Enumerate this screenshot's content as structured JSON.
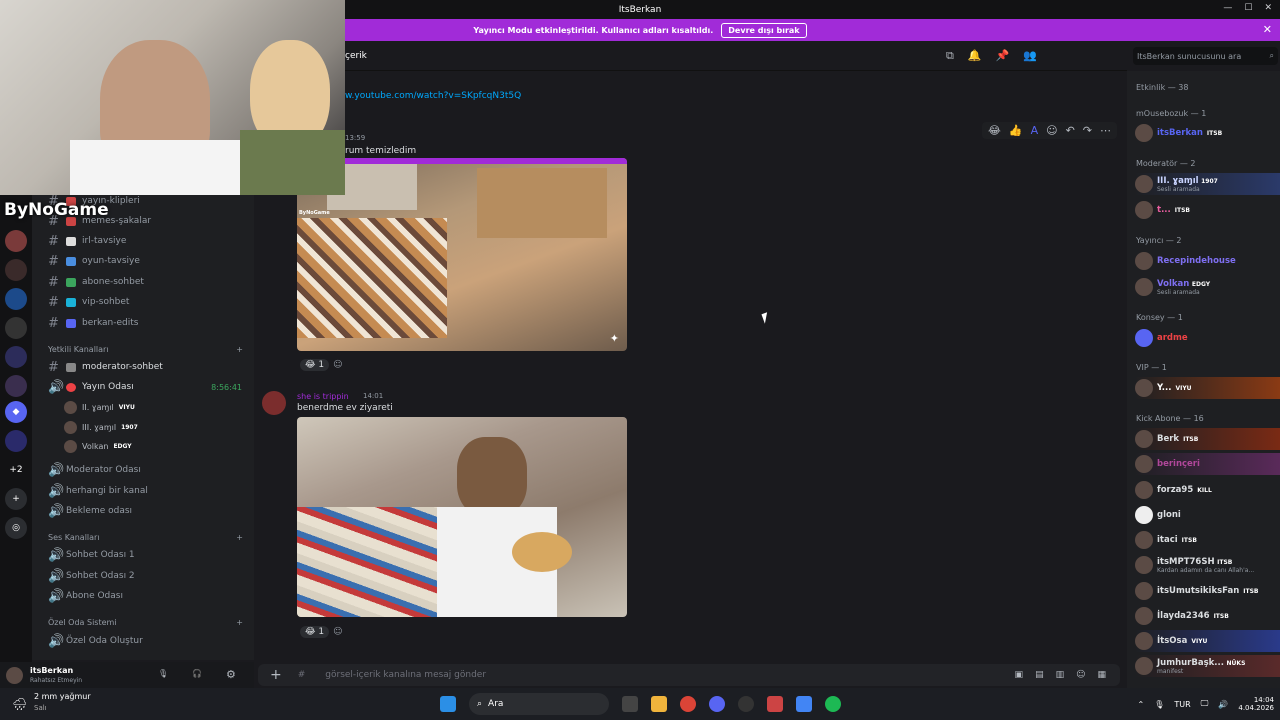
{
  "window": {
    "title": "ItsBerkan",
    "controls": [
      "—",
      "☐",
      "✕"
    ]
  },
  "banner": {
    "text": "Yayıncı Modu etkinleştirildi. Kullanıcı adları kısaltıldı.",
    "button": "Devre dışı bırak",
    "close": "✕"
  },
  "webcam": {
    "logo": "ByNoGame"
  },
  "header": {
    "channel": "çerik",
    "search_placeholder": "ItsBerkan sunucusunu ara"
  },
  "channels": {
    "text": [
      {
        "label": "yayın-klipleri"
      },
      {
        "label": "memes-şakalar"
      },
      {
        "label": "irl-tavsiye"
      },
      {
        "label": "oyun-tavsiye"
      },
      {
        "label": "abone-sohbet"
      },
      {
        "label": "vip-sohbet"
      },
      {
        "label": "berkan-edits"
      }
    ],
    "yetkili_cat": "Yetkili Kanalları",
    "moderator_sohbet": "moderator-sohbet",
    "yayin_odasi": "Yayın Odası",
    "yayin_timer": "8:56:41",
    "voice_users": [
      {
        "name": "II. ɣaɱıl",
        "badge": "VIYU"
      },
      {
        "name": "III. ɣaɱıl",
        "badge": "1907"
      },
      {
        "name": "Volkan",
        "badge": "EDGY"
      }
    ],
    "moderator_odasi": "Moderator Odası",
    "herhangi": "herhangi bir kanal",
    "bekleme": "Bekleme odası",
    "ses_cat": "Ses Kanalları",
    "ses": [
      "Sohbet Odası 1",
      "Sohbet Odası 2",
      "Abone Odası"
    ],
    "ozel_cat": "Özel Oda Sistemi",
    "ozel": "Özel Oda Oluştur"
  },
  "rail": {
    "more": "+2"
  },
  "user": {
    "name": "itsBerkan",
    "status": "Rahatsız Etmeyin"
  },
  "messages": {
    "link": "w.youtube.com/watch?v=SKpfcqN3t5Q",
    "time1": "13:59",
    "text1": "rum temizledim",
    "reaction1": "1",
    "author2": "she is trippin",
    "time2": "14:01",
    "text2": "benerdme ev ziyareti",
    "reaction2": "1",
    "image1_overlay": "ByNoGame"
  },
  "composer": {
    "placeholder": "görsel-içerik kanalına mesaj gönder"
  },
  "members": {
    "etkinlik": "Etkinlik — 38",
    "mousebozuk": "mOusebozuk — 1",
    "itsberkan": {
      "name": "itsBerkan",
      "badge": "ITSB"
    },
    "moderator_cat": "Moderatör — 2",
    "mods": [
      {
        "name": "III. ɣaɱıl",
        "badge": "1907",
        "sub": "Sesli aramada"
      },
      {
        "name": "t...",
        "badge": "ITSB",
        "sub": ""
      }
    ],
    "yayinci_cat": "Yayıncı — 2",
    "yayinci": [
      {
        "name": "Recepindehouse",
        "badge": "",
        "sub": ""
      },
      {
        "name": "Volkan",
        "badge": "EDGY",
        "sub": "Sesli aramada"
      }
    ],
    "konsey_cat": "Konsey — 1",
    "konsey": "ardme",
    "vip_cat": "VIP — 1",
    "vip": {
      "name": "Y...",
      "badge": "VIYU"
    },
    "kick_cat": "Kick Abone — 16",
    "kick": [
      {
        "name": "Berk",
        "badge": "ITSB",
        "sub": "",
        "color": "#ffffff"
      },
      {
        "name": "berinçeri",
        "badge": "",
        "sub": "",
        "color": "#b0479a"
      },
      {
        "name": "forza95",
        "badge": "KILL",
        "sub": "",
        "color": "#ffffff"
      },
      {
        "name": "gloni",
        "badge": "",
        "sub": "",
        "color": "#ffffff"
      },
      {
        "name": "itaci",
        "badge": "ITSB",
        "sub": "",
        "color": "#ffffff"
      },
      {
        "name": "itsMPT76SH",
        "badge": "ITSB",
        "sub": "Kardan adamın da canı Allah'a...",
        "color": "#ffffff"
      },
      {
        "name": "itsUmutsikiksFan",
        "badge": "ITSB",
        "sub": "",
        "color": "#ffffff"
      },
      {
        "name": "İlayda2346",
        "badge": "ITSB",
        "sub": "",
        "color": "#ffffff"
      },
      {
        "name": "İtsOsa",
        "badge": "VIYU",
        "sub": "",
        "color": "#ffffff"
      },
      {
        "name": "JumhurBaşk...",
        "badge": "NÜKS",
        "sub": "manifest",
        "color": "#ffffff"
      }
    ]
  },
  "taskbar": {
    "weather": "2 mm yağmur",
    "weather_sub": "Salı",
    "search": "Ara",
    "lang": "TUR",
    "time": "14:04",
    "date": "4.04.2026"
  }
}
